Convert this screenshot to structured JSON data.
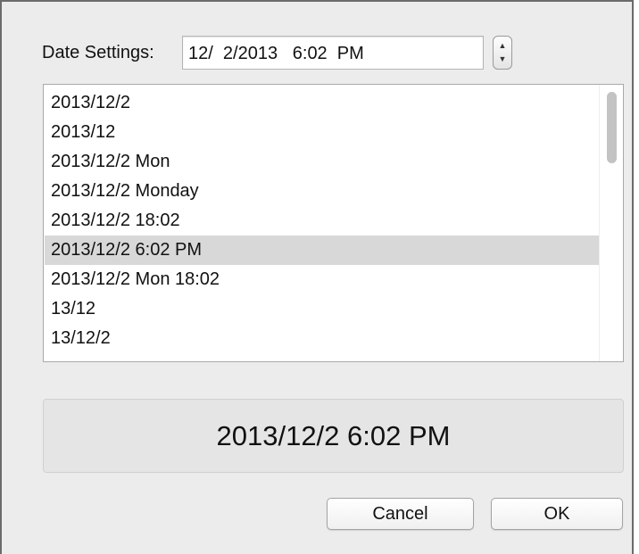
{
  "date_settings": {
    "label": "Date Settings:",
    "value": "12/  2/2013   6:02  PM"
  },
  "stepper": {
    "up_icon": "arrow-up-icon",
    "down_icon": "arrow-down-icon"
  },
  "format_list": {
    "items": [
      "2013/12/2",
      "2013/12",
      "2013/12/2 Mon",
      "2013/12/2 Monday",
      "2013/12/2 18:02",
      "2013/12/2 6:02 PM",
      "2013/12/2 Mon 18:02",
      "13/12",
      "13/12/2"
    ],
    "selected_index": 5
  },
  "preview": {
    "text": "2013/12/2 6:02 PM"
  },
  "buttons": {
    "cancel": "Cancel",
    "ok": "OK"
  },
  "colors": {
    "dialog_bg": "#ececec",
    "selection": "#d8d8d8"
  }
}
